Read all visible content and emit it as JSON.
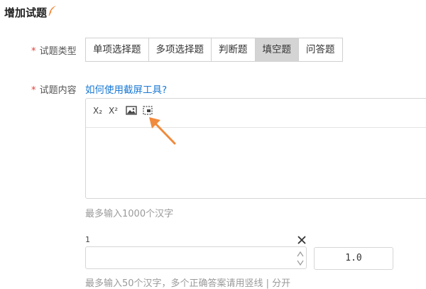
{
  "header": {
    "title": "增加试题"
  },
  "question_type": {
    "label": "试题类型",
    "options": [
      "单项选择题",
      "多项选择题",
      "判断题",
      "填空题",
      "问答题"
    ],
    "selected": "填空题"
  },
  "question_content": {
    "label": "试题内容",
    "help_link": "如何使用截屏工具?",
    "toolbar": [
      "subscript-icon",
      "superscript-icon",
      "image-icon",
      "screenshot-icon"
    ],
    "subscript_text": "X₂",
    "superscript_text": "X²",
    "hint": "最多输入1000个汉字"
  },
  "answer": {
    "index": "1",
    "value": "",
    "score": "1.0",
    "hint": "最多输入50个汉字，多个正确答案请用竖线 | 分开"
  },
  "colors": {
    "required": "#e0403a",
    "link": "#1a79d4",
    "arrow": "#f08a3c",
    "active_tab": "#d4d4d4"
  }
}
